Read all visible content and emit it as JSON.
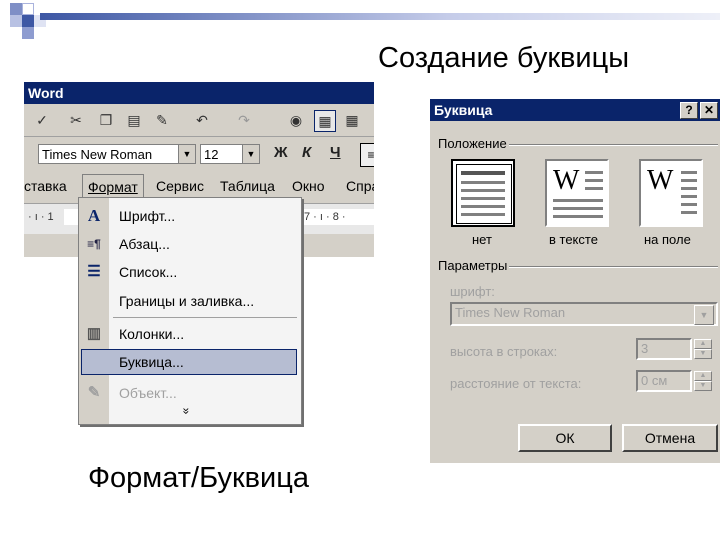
{
  "slide": {
    "title": "Создание  буквицы",
    "caption": "Формат/Буквица"
  },
  "word": {
    "title": "Word",
    "font_name": "Times New Roman",
    "font_size": "12",
    "bold_label": "Ж",
    "italic_label": "К",
    "underline_label": "Ч",
    "menubar": [
      "ставка",
      "Формат",
      "Сервис",
      "Таблица",
      "Окно",
      "Спра"
    ],
    "ruler_left": "· ı · 1",
    "ruler_right": "7 · ı · 8 ·"
  },
  "format_menu": {
    "items": [
      {
        "label": "Шрифт...",
        "icon": "A",
        "enabled": true
      },
      {
        "label": "Абзац...",
        "icon": "≡¶",
        "enabled": true
      },
      {
        "label": "Список...",
        "icon": "☰",
        "enabled": true
      },
      {
        "label": "Границы и заливка...",
        "icon": "",
        "enabled": true
      },
      {
        "label": "Колонки...",
        "icon": "▥",
        "enabled": true
      },
      {
        "label": "Буквица...",
        "icon": "",
        "enabled": true,
        "selected": true
      },
      {
        "label": "Объект...",
        "icon": "✎",
        "enabled": false
      }
    ],
    "more_label": "»"
  },
  "dialog": {
    "title": "Буквица",
    "help_btn": "?",
    "close_btn": "✕",
    "position_group": "Положение",
    "position_options": [
      "нет",
      "в тексте",
      "на поле"
    ],
    "selected_position": "нет",
    "params_group": "Параметры",
    "font_label": "шрифт:",
    "font_value": "Times New Roman",
    "height_label": "высота в строках:",
    "height_value": "3",
    "distance_label": "расстояние от текста:",
    "distance_value": "0 см",
    "ok_label": "ОК",
    "cancel_label": "Отмена",
    "drop_letter": "W"
  },
  "colors": {
    "titlebar": "#0a246a",
    "face": "#d4d0c8",
    "menu_highlight": "#b6bdd2",
    "deco_blue": "#3d57a4"
  }
}
